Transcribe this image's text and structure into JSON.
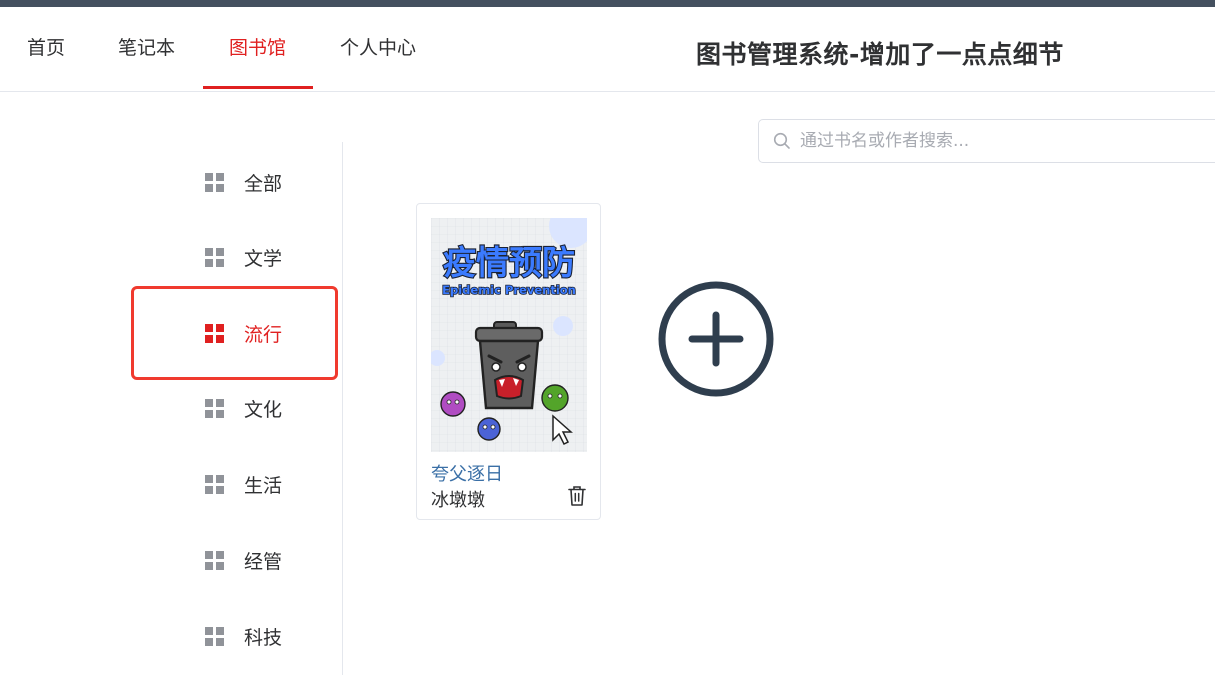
{
  "nav": {
    "items": [
      {
        "label": "首页",
        "active": false
      },
      {
        "label": "笔记本",
        "active": false
      },
      {
        "label": "图书馆",
        "active": true
      },
      {
        "label": "个人中心",
        "active": false
      }
    ]
  },
  "header": {
    "title": "图书管理系统-增加了一点点细节"
  },
  "search": {
    "placeholder": "通过书名或作者搜索..."
  },
  "sidebar": {
    "categories": [
      {
        "label": "全部",
        "active": false
      },
      {
        "label": "文学",
        "active": false
      },
      {
        "label": "流行",
        "active": true
      },
      {
        "label": "文化",
        "active": false
      },
      {
        "label": "生活",
        "active": false
      },
      {
        "label": "经管",
        "active": false
      },
      {
        "label": "科技",
        "active": false
      }
    ]
  },
  "books": [
    {
      "title": "夸父逐日",
      "author": "冰墩墩",
      "cover": {
        "headline": "疫情预防",
        "subheadline": "Epidemic Prevention"
      }
    }
  ],
  "colors": {
    "accent": "#e02020",
    "text": "#303133",
    "muted_icon": "#909399",
    "link": "#3a6fa6",
    "add_icon": "#2f3e4e",
    "highlight_box": "#f03a2e"
  },
  "icons": {
    "search": "search-icon",
    "category": "grid-icon",
    "delete": "trash-icon",
    "add": "plus-circle-icon"
  }
}
